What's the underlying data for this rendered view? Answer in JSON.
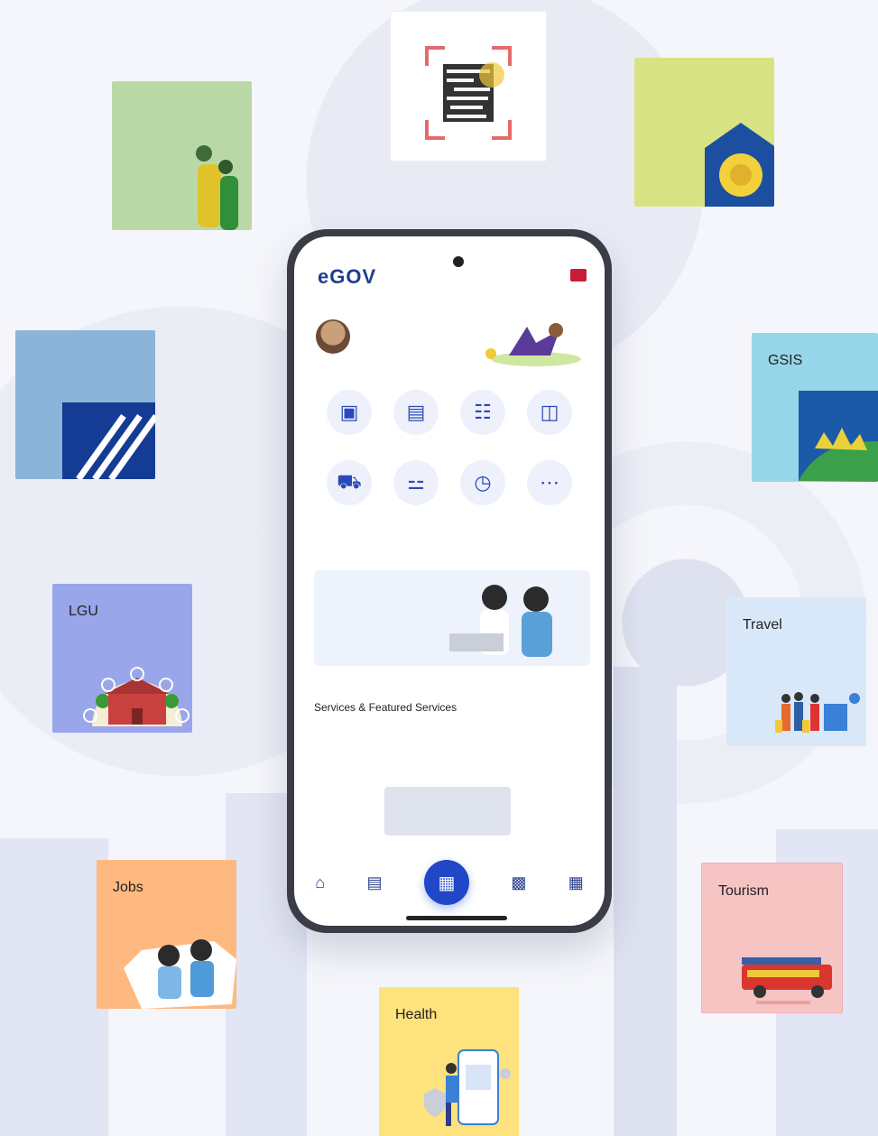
{
  "cards": {
    "gsis": "GSIS",
    "lgu": "LGU",
    "travel": "Travel",
    "jobs": "Jobs",
    "tourism": "Tourism",
    "health": "Health"
  },
  "app": {
    "logo": "eGOV",
    "feature_title": "Services & Featured Services",
    "services": [
      {
        "label": "",
        "icon": "building-icon"
      },
      {
        "label": "",
        "icon": "building-icon"
      },
      {
        "label": "",
        "icon": "document-icon"
      },
      {
        "label": "",
        "icon": "chair-icon"
      },
      {
        "label": "",
        "icon": "car-icon"
      },
      {
        "label": "",
        "icon": "pill-icon"
      },
      {
        "label": "",
        "icon": "clock-icon"
      },
      {
        "label": "",
        "icon": "more-icon"
      }
    ],
    "nav": [
      {
        "label": "",
        "icon": "home-icon"
      },
      {
        "label": "",
        "icon": "folder-icon"
      },
      {
        "label": "",
        "icon": "scan-icon"
      },
      {
        "label": "",
        "icon": "briefcase-icon"
      },
      {
        "label": "",
        "icon": "grid-icon"
      }
    ]
  }
}
